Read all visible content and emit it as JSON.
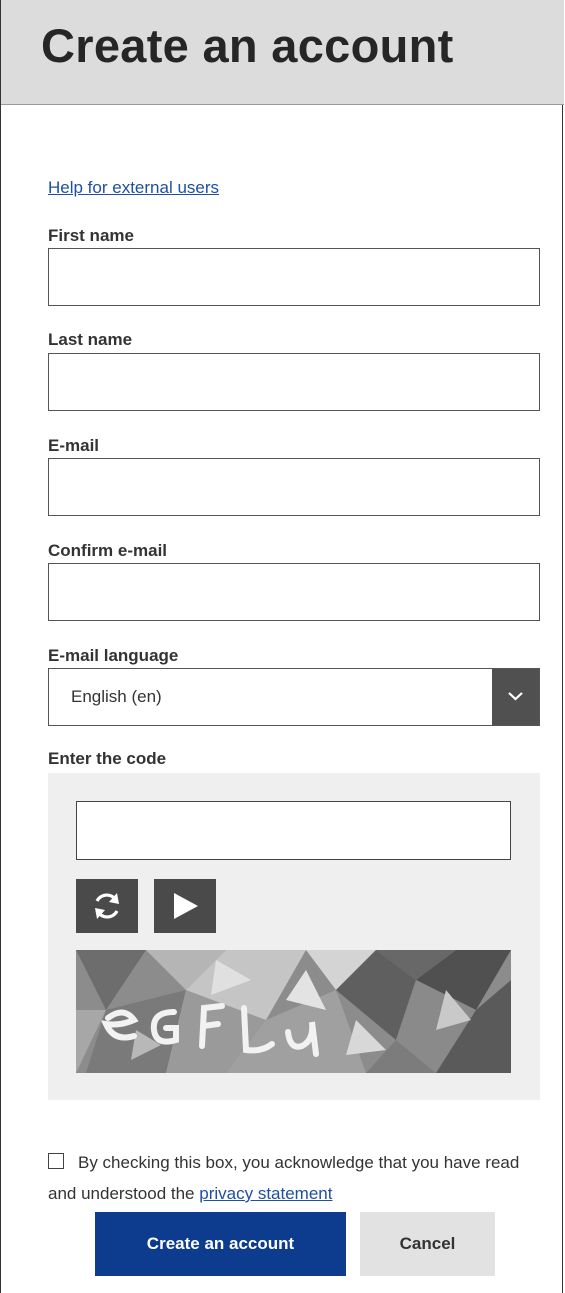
{
  "header": {
    "title": "Create an account"
  },
  "help_link": "Help for external users",
  "fields": {
    "first_name": {
      "label": "First name",
      "value": ""
    },
    "last_name": {
      "label": "Last name",
      "value": ""
    },
    "email": {
      "label": "E-mail",
      "value": ""
    },
    "confirm_email": {
      "label": "Confirm e-mail",
      "value": ""
    }
  },
  "language": {
    "label": "E-mail language",
    "selected": "English (en)"
  },
  "captcha": {
    "label": "Enter the code",
    "value": "",
    "refresh_icon": "refresh-icon",
    "play_icon": "play-audio-icon"
  },
  "consent": {
    "text": "By checking this box, you acknowledge that you have read and understood the",
    "link": "privacy statement",
    "checked": false
  },
  "buttons": {
    "create": "Create an account",
    "cancel": "Cancel"
  },
  "colors": {
    "header_bg": "#dcdcdc",
    "primary": "#0d3c8f",
    "link": "#1f4fa3",
    "secondary_bg": "#e2e2e2",
    "dark_control": "#4a4a4a"
  }
}
